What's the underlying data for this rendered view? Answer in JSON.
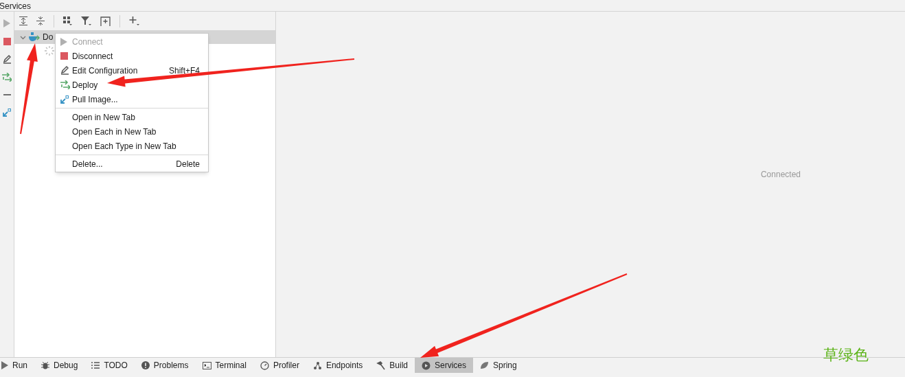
{
  "window": {
    "title": "Services"
  },
  "side_toolbar": [
    {
      "kind": "play",
      "disabled": true
    },
    {
      "kind": "stop",
      "disabled": false
    },
    {
      "kind": "edit",
      "disabled": false
    },
    {
      "kind": "deploy",
      "disabled": false
    },
    {
      "kind": "minus",
      "disabled": false
    },
    {
      "kind": "pull",
      "disabled": false
    }
  ],
  "tree": [
    {
      "label": "Do",
      "selected": true,
      "expanded": true,
      "children": [
        {
          "kind": "loading"
        }
      ]
    }
  ],
  "context_menu": {
    "groups": [
      [
        {
          "label": "Connect",
          "kind": "play",
          "disabled": true
        },
        {
          "label": "Disconnect",
          "kind": "stop",
          "disabled": false
        },
        {
          "label": "Edit Configuration",
          "kind": "edit",
          "shortcut": "Shift+F4",
          "disabled": false
        },
        {
          "label": "Deploy",
          "kind": "deploy",
          "disabled": false
        },
        {
          "label": "Pull Image...",
          "kind": "pull",
          "disabled": false
        }
      ],
      [
        {
          "label": "Open in New Tab",
          "disabled": false
        },
        {
          "label": "Open Each in New Tab",
          "disabled": false
        },
        {
          "label": "Open Each Type in New Tab",
          "disabled": false
        }
      ],
      [
        {
          "label": "Delete...",
          "shortcut": "Delete",
          "disabled": false
        }
      ]
    ]
  },
  "detail": {
    "status": "Connected"
  },
  "bottom_tabs": [
    {
      "label": "Run",
      "kind": "play",
      "selected": false
    },
    {
      "label": "Debug",
      "kind": "bug",
      "selected": false
    },
    {
      "label": "TODO",
      "kind": "list",
      "selected": false
    },
    {
      "label": "Problems",
      "kind": "alert",
      "selected": false
    },
    {
      "label": "Terminal",
      "kind": "terminal",
      "selected": false
    },
    {
      "label": "Profiler",
      "kind": "profiler",
      "selected": false
    },
    {
      "label": "Endpoints",
      "kind": "endpoints",
      "selected": false
    },
    {
      "label": "Build",
      "kind": "hammer",
      "selected": false
    },
    {
      "label": "Services",
      "kind": "services",
      "selected": true
    },
    {
      "label": "Spring",
      "kind": "leaf",
      "selected": false
    }
  ],
  "annotation": {
    "label": "草绿色"
  }
}
